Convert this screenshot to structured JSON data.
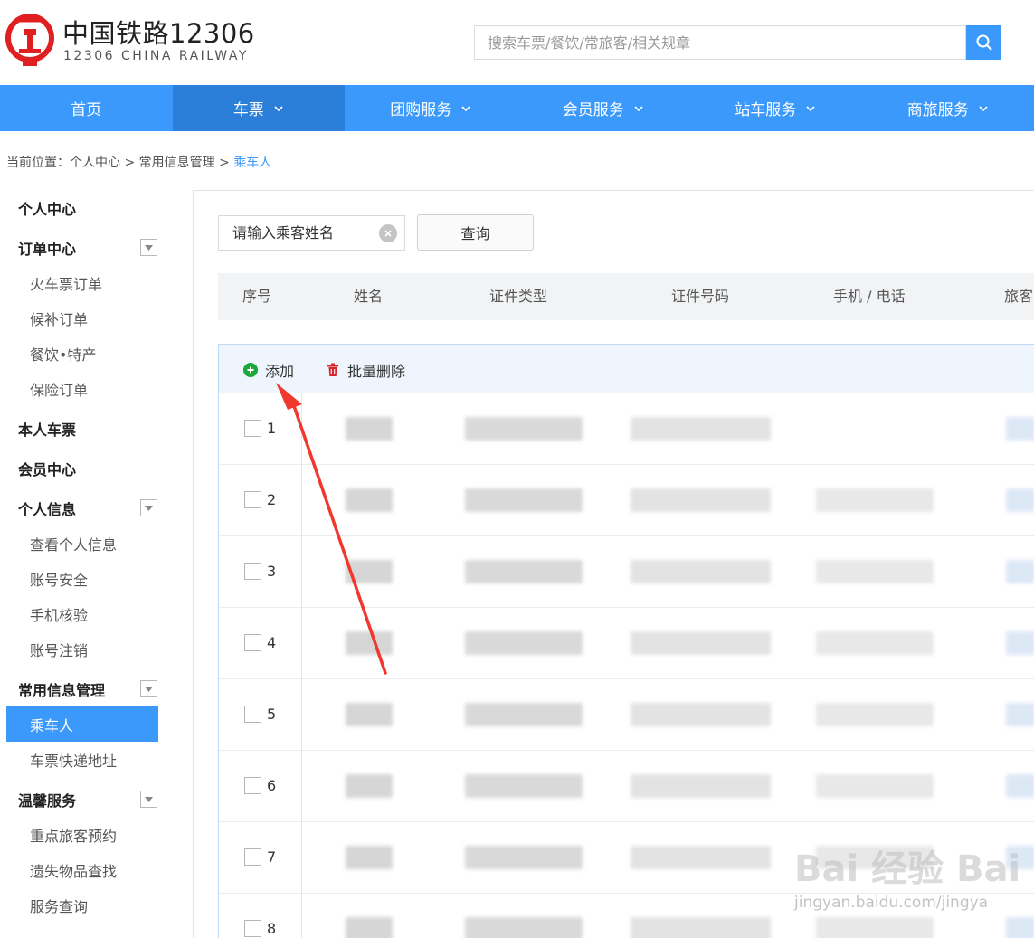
{
  "header": {
    "logo_title": "中国铁路12306",
    "logo_subtitle": "12306 CHINA RAILWAY",
    "search_placeholder": "搜索车票/餐饮/常旅客/相关规章",
    "brand_color": "#e02020"
  },
  "nav": {
    "items": [
      {
        "label": "首页",
        "has_dropdown": false,
        "active": false
      },
      {
        "label": "车票",
        "has_dropdown": true,
        "active": true
      },
      {
        "label": "团购服务",
        "has_dropdown": true,
        "active": false
      },
      {
        "label": "会员服务",
        "has_dropdown": true,
        "active": false
      },
      {
        "label": "站车服务",
        "has_dropdown": true,
        "active": false
      },
      {
        "label": "商旅服务",
        "has_dropdown": true,
        "active": false
      }
    ],
    "bg_color": "#3b99fc"
  },
  "breadcrumb": {
    "prefix": "当前位置：个人中心 > 常用信息管理 > ",
    "current": "乘车人"
  },
  "sidebar": {
    "items": [
      {
        "label": "个人中心",
        "type": "group"
      },
      {
        "label": "订单中心",
        "type": "group",
        "toggle": true
      },
      {
        "label": "火车票订单",
        "type": "sub"
      },
      {
        "label": "候补订单",
        "type": "sub"
      },
      {
        "label": "餐饮•特产",
        "type": "sub"
      },
      {
        "label": "保险订单",
        "type": "sub"
      },
      {
        "label": "本人车票",
        "type": "group"
      },
      {
        "label": "会员中心",
        "type": "group"
      },
      {
        "label": "个人信息",
        "type": "group",
        "toggle": true
      },
      {
        "label": "查看个人信息",
        "type": "sub"
      },
      {
        "label": "账号安全",
        "type": "sub"
      },
      {
        "label": "手机核验",
        "type": "sub"
      },
      {
        "label": "账号注销",
        "type": "sub"
      },
      {
        "label": "常用信息管理",
        "type": "group",
        "toggle": true
      },
      {
        "label": "乘车人",
        "type": "sub",
        "active": true
      },
      {
        "label": "车票快递地址",
        "type": "sub"
      },
      {
        "label": "温馨服务",
        "type": "group",
        "toggle": true
      },
      {
        "label": "重点旅客预约",
        "type": "sub"
      },
      {
        "label": "遗失物品查找",
        "type": "sub"
      },
      {
        "label": "服务查询",
        "type": "sub"
      }
    ]
  },
  "filter": {
    "name_placeholder": "请输入乘客姓名",
    "query_label": "查询"
  },
  "table": {
    "headers": [
      "序号",
      "姓名",
      "证件类型",
      "证件号码",
      "手机 / 电话",
      "旅客"
    ],
    "toolbar": {
      "add_label": "添加",
      "delete_label": "批量删除"
    },
    "rows": [
      "1",
      "2",
      "3",
      "4",
      "5",
      "6",
      "7",
      "8"
    ]
  },
  "watermark": {
    "main": "Bai 经验 Bai",
    "url": "jingyan.baidu.com/jingya"
  }
}
